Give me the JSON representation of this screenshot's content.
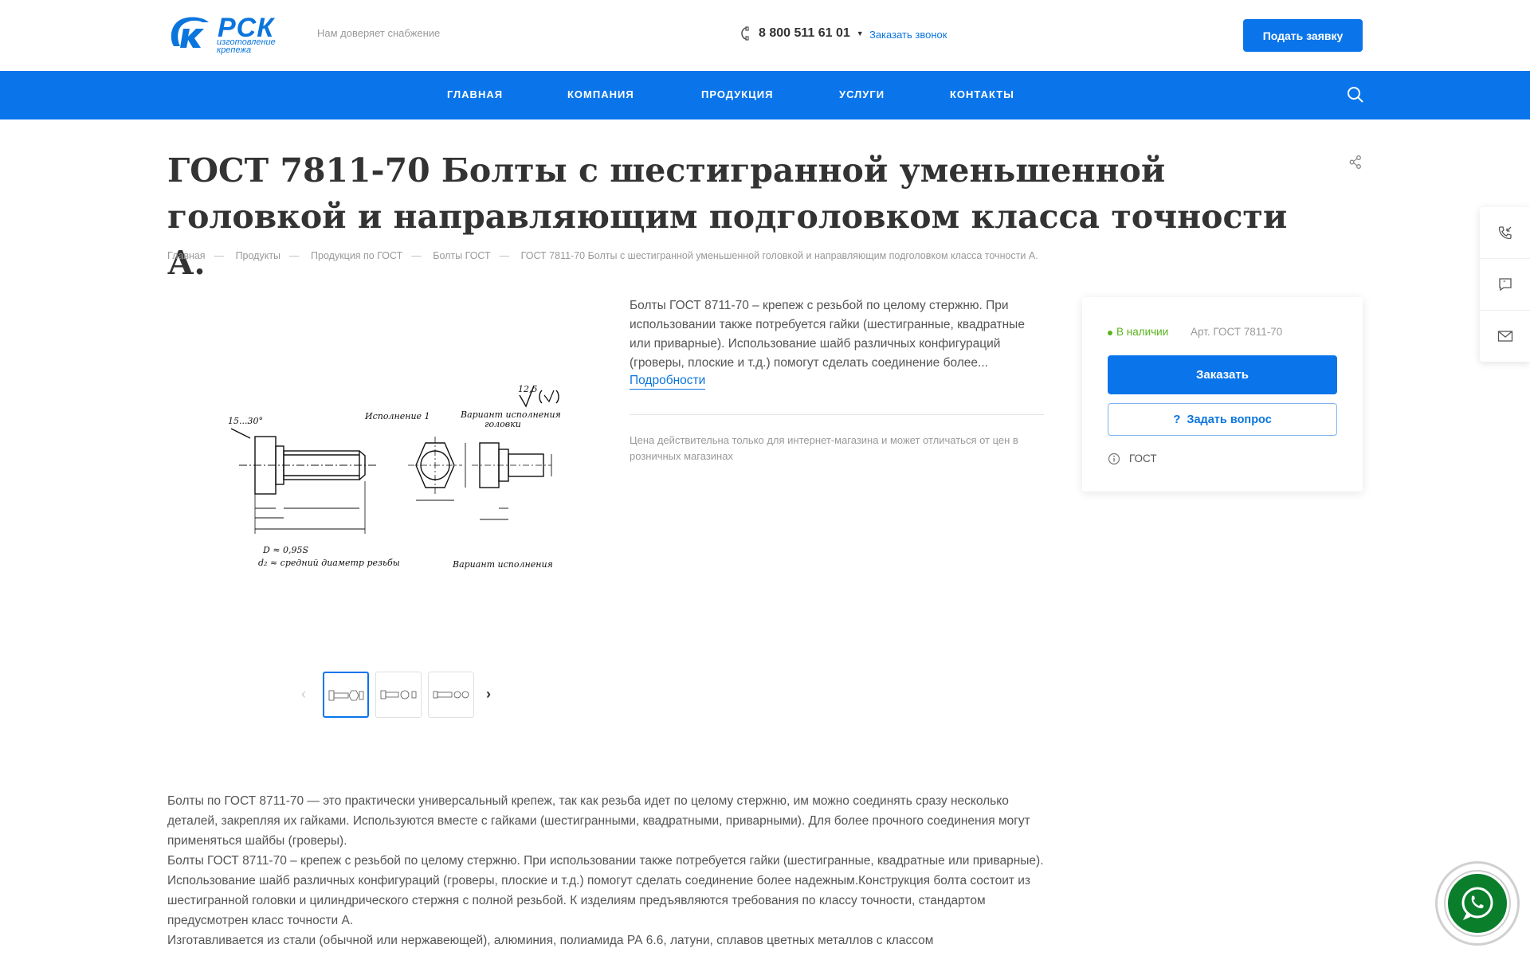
{
  "header": {
    "logo_text": "РСК",
    "logo_sub1": "изготовление",
    "logo_sub2": "крепежа",
    "tagline": "Нам доверяет снабжение",
    "phone": "8 800 511 61 01",
    "callback": "Заказать звонок",
    "submit_button": "Подать заявку"
  },
  "nav": {
    "items": [
      "Главная",
      "Компания",
      "Продукция",
      "Услуги",
      "Контакты"
    ]
  },
  "page": {
    "title": "ГОСТ 7811-70 Болты с шестигранной уменьшенной головкой и направляющим подголовком класса точности А."
  },
  "breadcrumb": [
    "Главная",
    "Продукты",
    "Продукция по ГОСТ",
    "Болты ГОСТ",
    "ГОСТ 7811-70 Болты с шестигранной уменьшенной головкой и направляющим подголовком класса точности А."
  ],
  "product": {
    "short_description": "Болты ГОСТ 8711-70 – крепеж с резьбой по целому стержню. При использовании также потребуется гайки (шестигранные, квадратные или приварные). Использование шайб различных конфигураций (гроверы, плоские и т.д.) помогут сделать соединение более...",
    "more_link": "Подробности",
    "price_note": "Цена действительна только для интернет-магазина и может отличаться от цен в розничных магазинах",
    "stock": "В наличии",
    "article": "Арт. ГОСТ 7811-70",
    "order_button": "Заказать",
    "question_button": "Задать вопрос",
    "gost_label": "ГОСТ"
  },
  "drawing": {
    "angle_label": "15...30°",
    "variant1": "Исполнение 1",
    "variant_head1": "Вариант исполнения",
    "variant_head2": "головки",
    "roughness": "12,5",
    "formula1": "D ≈ 0,95S",
    "formula2": "d₂ ≈ средний диаметр резьбы",
    "variant_bottom": "Вариант исполнения"
  },
  "body": {
    "paragraphs": [
      "Болты по ГОСТ 8711-70 — это практически универсальный крепеж, так как резьба идет по целому стержню, им можно соединять сразу несколько деталей, закрепляя их гайками. Используются вместе с гайками (шестигранными, квадратными, приварными). Для более прочного соединения могут применяться шайбы (гроверы).",
      "Болты ГОСТ 8711-70 – крепеж с резьбой по целому стержню. При использовании также потребуется гайки (шестигранные, квадратные или приварные). Использование шайб различных конфигураций (гроверы, плоские и т.д.) помогут сделать соединение более надежным.Конструкция болта состоит из шестигранной головки и цилиндрического стержня с полной резьбой. К изделиям предъявляются требования по классу точности, стандартом предусмотрен класс точности А.",
      "Изготавливается из стали (обычной или нержавеющей), алюминия, полиамида РА 6.6, латуни, сплавов цветных металлов с классом"
    ]
  },
  "colors": {
    "brand_blue": "#0a75ea",
    "in_stock": "#58b41a",
    "whatsapp": "#0b7e2b"
  }
}
